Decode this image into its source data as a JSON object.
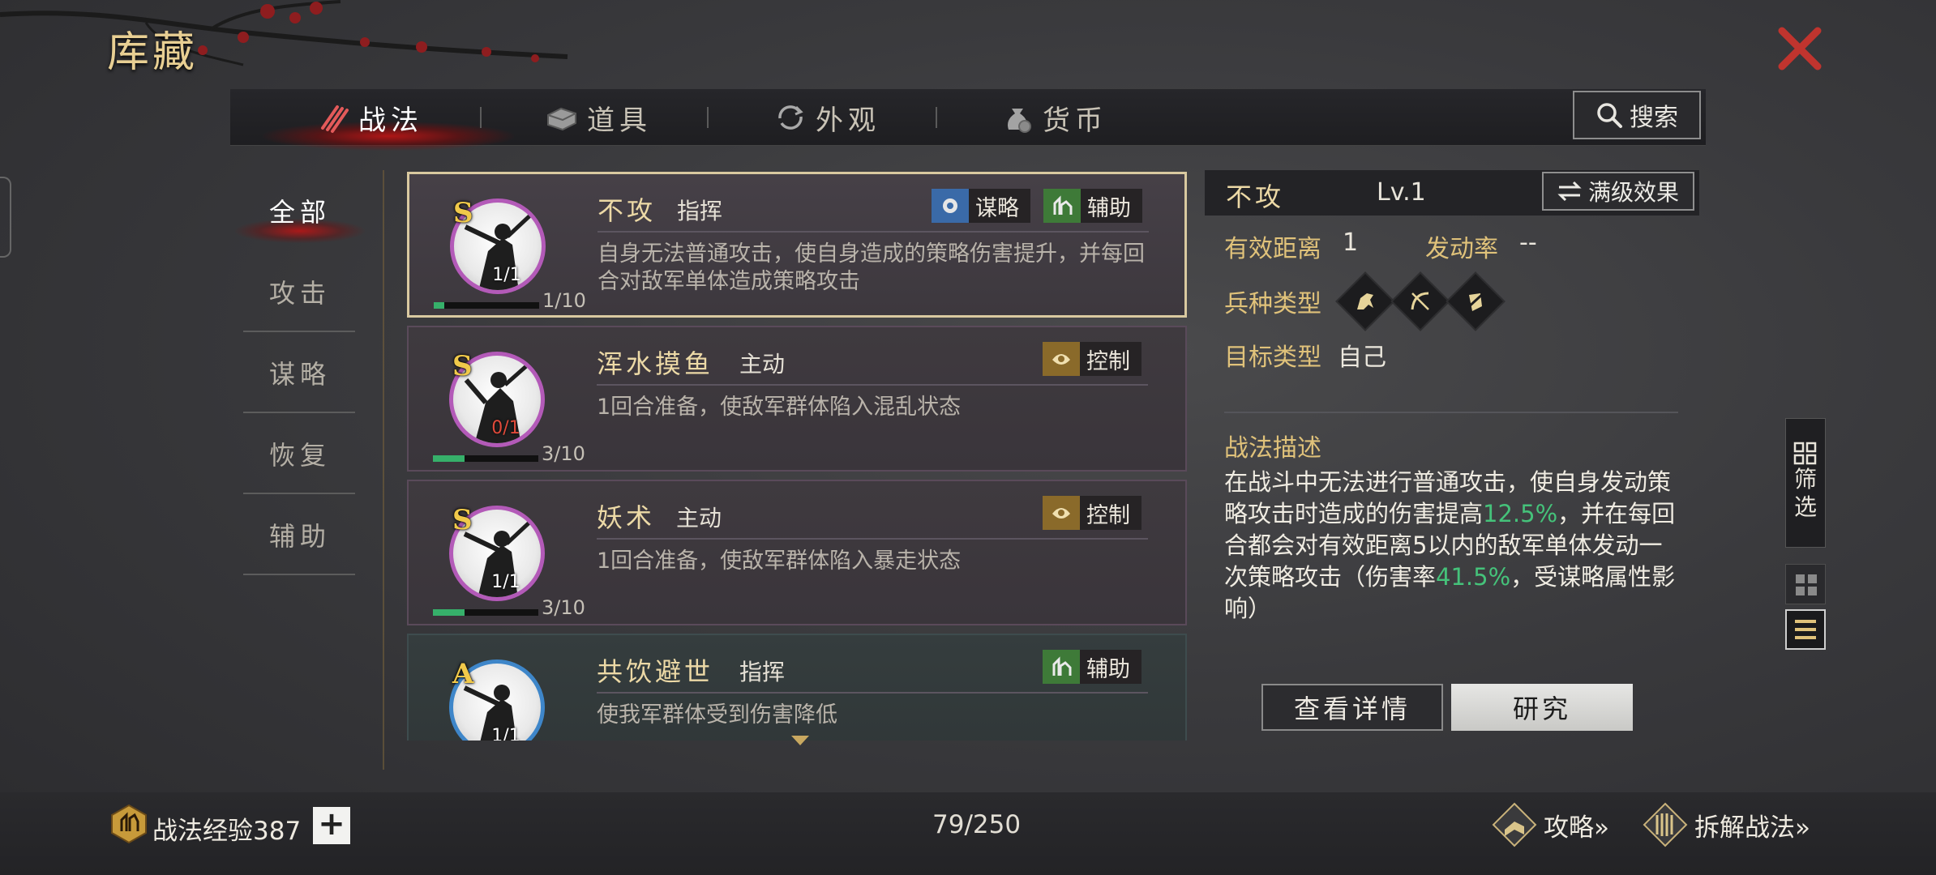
{
  "title": "库藏",
  "tabs": [
    {
      "label": "战法",
      "icon": "scroll-bundle-icon",
      "active": true
    },
    {
      "label": "道具",
      "icon": "chest-icon",
      "active": false
    },
    {
      "label": "外观",
      "icon": "cycle-arrows-icon",
      "active": false
    },
    {
      "label": "货币",
      "icon": "money-bag-icon",
      "active": false
    }
  ],
  "search_label": "搜索",
  "categories": [
    "全部",
    "攻击",
    "谋略",
    "恢复",
    "辅助"
  ],
  "skills": [
    {
      "grade": "S",
      "name": "不攻",
      "type": "指挥",
      "tags": [
        "谋略",
        "辅助"
      ],
      "count": "1/1",
      "progress": "1/10",
      "progress_fraction": 0.1,
      "desc": "自身无法普通攻击，使自身造成的策略伤害提升，并每回合对敌军单体造成策略攻击"
    },
    {
      "grade": "S",
      "name": "浑水摸鱼",
      "type": "主动",
      "tags": [
        "控制"
      ],
      "count": "0/1",
      "progress": "3/10",
      "progress_fraction": 0.3,
      "desc": "1回合准备，使敌军群体陷入混乱状态"
    },
    {
      "grade": "S",
      "name": "妖术",
      "type": "主动",
      "tags": [
        "控制"
      ],
      "count": "1/1",
      "progress": "3/10",
      "progress_fraction": 0.3,
      "desc": "1回合准备，使敌军群体陷入暴走状态"
    },
    {
      "grade": "A",
      "name": "共饮避世",
      "type": "指挥",
      "tags": [
        "辅助"
      ],
      "count": "1/1",
      "desc": "使我军群体受到伤害降低"
    }
  ],
  "detail": {
    "name": "不攻",
    "level": "Lv.1",
    "max_level_label": "满级效果",
    "range_label": "有效距离",
    "range_value": "1",
    "rate_label": "发动率",
    "rate_value": "--",
    "unit_label": "兵种类型",
    "unit_icons": [
      "cavalry-icon",
      "archer-icon",
      "shield-icon"
    ],
    "target_label": "目标类型",
    "target_value": "自己",
    "desc_title": "战法描述",
    "desc_parts": [
      "在战斗中无法进行普通攻击，使自身发动策略攻击时造成的伤害提高",
      "12.5%",
      "，并在每回合都会对有效距离5以内的敌军单体发动一次策略攻击（伤害率",
      "41.5%",
      "，受谋略属性影响）"
    ],
    "view_details_label": "查看详情",
    "research_label": "研究"
  },
  "filter_label": [
    "筛",
    "选"
  ],
  "bottom": {
    "exp_label": "战法经验387",
    "plus": "+",
    "capacity": "79/250",
    "guide_label": "攻略»",
    "dismantle_label": "拆解战法»"
  },
  "colors": {
    "gold": "#e0c27a",
    "highlight_green": "#45c27a",
    "s_border": "#b35ab8",
    "a_border": "#3e86c9",
    "progress": "#36b06a"
  }
}
